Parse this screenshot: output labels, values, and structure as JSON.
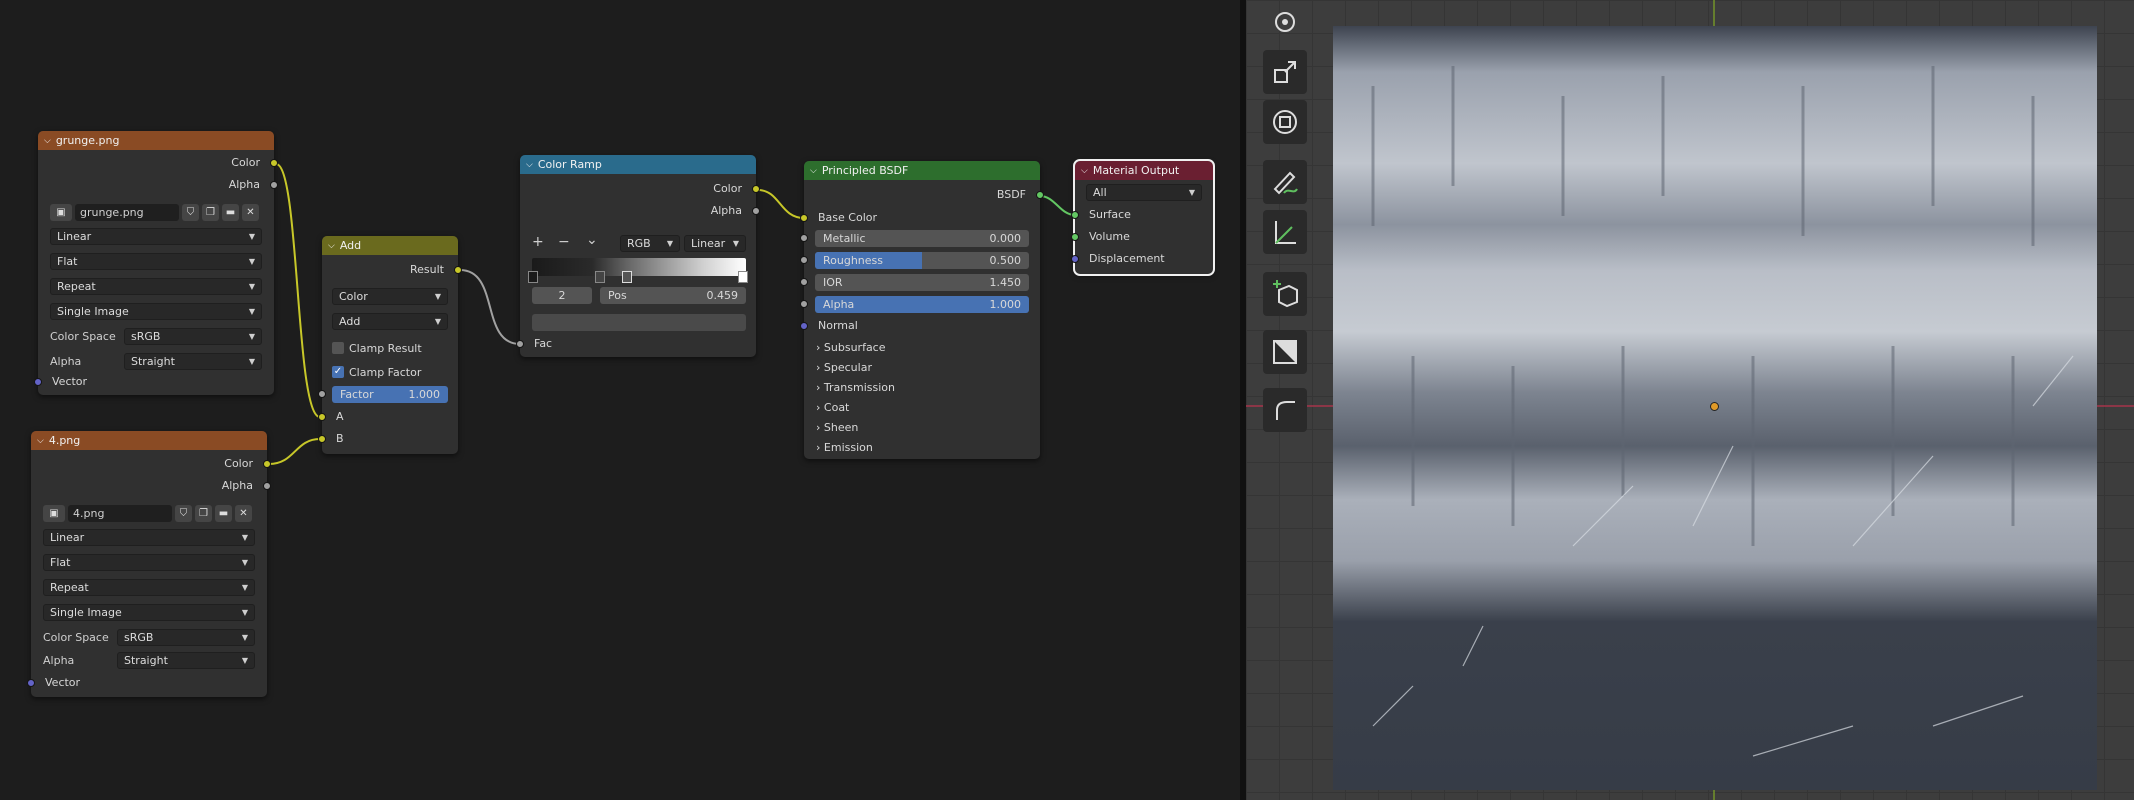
{
  "nodes": {
    "grunge": {
      "title": "grunge.png",
      "color_label": "Color",
      "alpha_label": "Alpha",
      "image_name": "grunge.png",
      "interpolation": "Linear",
      "projection": "Flat",
      "extension": "Repeat",
      "source": "Single Image",
      "color_space_label": "Color Space",
      "color_space": "sRGB",
      "alpha_mode_label": "Alpha",
      "alpha_mode": "Straight",
      "vector_label": "Vector"
    },
    "img4": {
      "title": "4.png",
      "color_label": "Color",
      "alpha_label": "Alpha",
      "image_name": "4.png",
      "interpolation": "Linear",
      "projection": "Flat",
      "extension": "Repeat",
      "source": "Single Image",
      "color_space_label": "Color Space",
      "color_space": "sRGB",
      "alpha_mode_label": "Alpha",
      "alpha_mode": "Straight",
      "vector_label": "Vector"
    },
    "add": {
      "title": "Add",
      "result_label": "Result",
      "type": "Color",
      "operation": "Add",
      "clamp_result": "Clamp Result",
      "clamp_factor": "Clamp Factor",
      "factor_label": "Factor",
      "factor_value": "1.000",
      "a_label": "A",
      "b_label": "B"
    },
    "ramp": {
      "title": "Color Ramp",
      "color_label": "Color",
      "alpha_label": "Alpha",
      "add_btn": "+",
      "remove_btn": "−",
      "menu_btn": "⌄",
      "color_mode": "RGB",
      "interpolation": "Linear",
      "stop_index": "2",
      "pos_label": "Pos",
      "pos_value": "0.459",
      "fac_label": "Fac"
    },
    "bsdf": {
      "title": "Principled BSDF",
      "bsdf_label": "BSDF",
      "base_color": "Base Color",
      "metallic_label": "Metallic",
      "metallic_value": "0.000",
      "roughness_label": "Roughness",
      "roughness_value": "0.500",
      "roughness_fill": 0.5,
      "ior_label": "IOR",
      "ior_value": "1.450",
      "alpha_label": "Alpha",
      "alpha_value": "1.000",
      "normal_label": "Normal",
      "panels": [
        "Subsurface",
        "Specular",
        "Transmission",
        "Coat",
        "Sheen",
        "Emission"
      ]
    },
    "output": {
      "title": "Material Output",
      "target": "All",
      "surface": "Surface",
      "volume": "Volume",
      "displacement": "Displacement"
    }
  },
  "colors": {
    "texture_header": "#8a4b24",
    "converter_header": "#6a6a1e",
    "ramp_header": "#2a6b8c",
    "shader_header": "#2d6e2d",
    "output_header": "#6a1f31",
    "accent_blue": "#4772b3"
  },
  "viewport": {
    "tools": [
      "orbit-icon",
      "scale-icon",
      "transform-icon",
      "annotate-icon",
      "measure-icon",
      "add-cube-icon",
      "uv-icon",
      "rounded-edge-icon"
    ]
  }
}
